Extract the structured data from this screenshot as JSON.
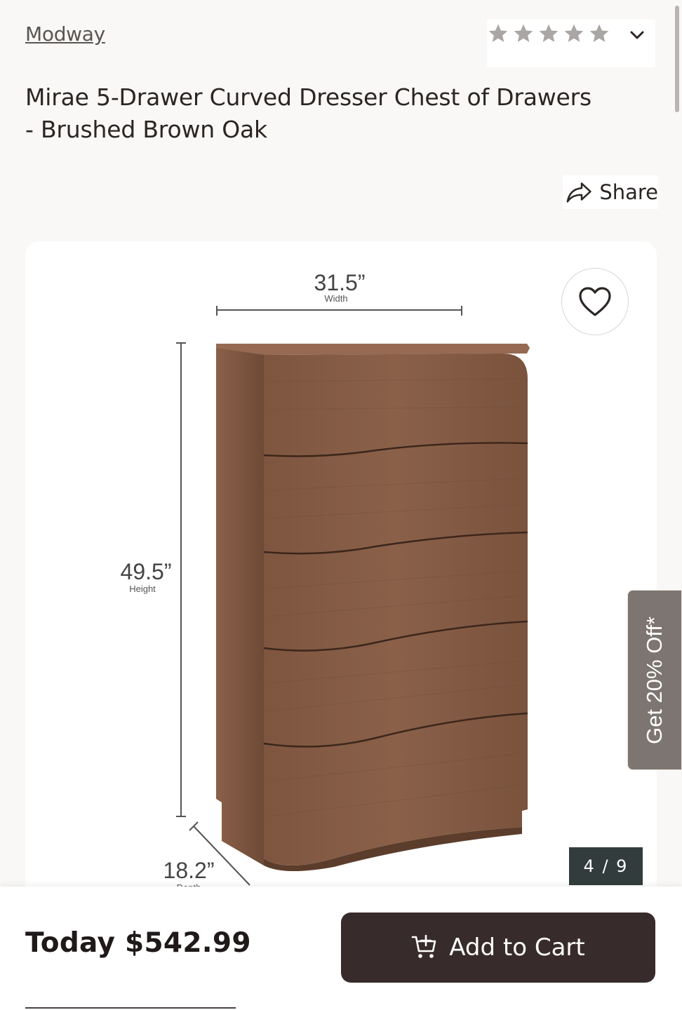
{
  "header": {
    "brand": "Modway",
    "rating": {
      "filled_stars": 0,
      "max_stars": 5
    },
    "expand_icon": "chevron-down-icon"
  },
  "product": {
    "title": "Mirae 5-Drawer Curved Dresser Chest of Drawers - Brushed Brown Oak"
  },
  "share": {
    "label": "Share",
    "icon": "share-arrow-icon"
  },
  "gallery": {
    "image_labels": {
      "width_value": "31.5”",
      "width_label": "Width",
      "height_value": "49.5”",
      "height_label": "Height",
      "depth_value": "18.2”",
      "depth_label": "Depth"
    },
    "favorite_icon": "heart-icon",
    "counter": "4 / 9"
  },
  "promo": {
    "label": "Get 20% Off*"
  },
  "purchase": {
    "price": "Today $542.99",
    "add_to_cart_label": "Add to Cart",
    "cart_icon": "cart-plus-icon"
  },
  "colors": {
    "background": "#f9f8f6",
    "button": "#382b2b",
    "counter": "#333c3c",
    "promo": "#7d7571",
    "star_empty": "#a9a6a4"
  }
}
